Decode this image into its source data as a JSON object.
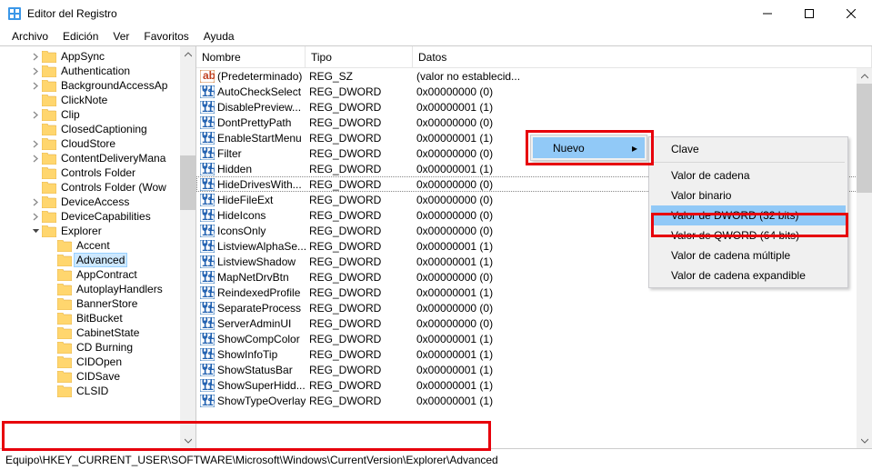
{
  "window": {
    "title": "Editor del Registro"
  },
  "menu": {
    "items": [
      "Archivo",
      "Edición",
      "Ver",
      "Favoritos",
      "Ayuda"
    ]
  },
  "tree": {
    "items": [
      {
        "label": "AppSync",
        "chev": "r"
      },
      {
        "label": "Authentication",
        "chev": "r"
      },
      {
        "label": "BackgroundAccessAp",
        "chev": "r"
      },
      {
        "label": "ClickNote",
        "chev": ""
      },
      {
        "label": "Clip",
        "chev": "r"
      },
      {
        "label": "ClosedCaptioning",
        "chev": ""
      },
      {
        "label": "CloudStore",
        "chev": "r"
      },
      {
        "label": "ContentDeliveryMana",
        "chev": "r"
      },
      {
        "label": "Controls Folder",
        "chev": ""
      },
      {
        "label": "Controls Folder (Wow",
        "chev": ""
      },
      {
        "label": "DeviceAccess",
        "chev": "r"
      },
      {
        "label": "DeviceCapabilities",
        "chev": "r"
      },
      {
        "label": "Explorer",
        "chev": "d",
        "expanded": true,
        "children": [
          {
            "label": "Accent"
          },
          {
            "label": "Advanced",
            "selected": true
          },
          {
            "label": "AppContract"
          },
          {
            "label": "AutoplayHandlers"
          },
          {
            "label": "BannerStore"
          },
          {
            "label": "BitBucket"
          },
          {
            "label": "CabinetState"
          },
          {
            "label": "CD Burning"
          },
          {
            "label": "CIDOpen"
          },
          {
            "label": "CIDSave"
          },
          {
            "label": "CLSID"
          }
        ]
      }
    ]
  },
  "list": {
    "columns": [
      "Nombre",
      "Tipo",
      "Datos"
    ],
    "rows": [
      {
        "icon": "str",
        "name": "(Predeterminado)",
        "type": "REG_SZ",
        "data": "(valor no establecid...",
        "sel": false
      },
      {
        "icon": "bin",
        "name": "AutoCheckSelect",
        "type": "REG_DWORD",
        "data": "0x00000000 (0)"
      },
      {
        "icon": "bin",
        "name": "DisablePreview...",
        "type": "REG_DWORD",
        "data": "0x00000001 (1)"
      },
      {
        "icon": "bin",
        "name": "DontPrettyPath",
        "type": "REG_DWORD",
        "data": "0x00000000 (0)"
      },
      {
        "icon": "bin",
        "name": "EnableStartMenu",
        "type": "REG_DWORD",
        "data": "0x00000001 (1)"
      },
      {
        "icon": "bin",
        "name": "Filter",
        "type": "REG_DWORD",
        "data": "0x00000000 (0)"
      },
      {
        "icon": "bin",
        "name": "Hidden",
        "type": "REG_DWORD",
        "data": "0x00000001 (1)"
      },
      {
        "icon": "bin",
        "name": "HideDrivesWith...",
        "type": "REG_DWORD",
        "data": "0x00000000 (0)",
        "sel": true
      },
      {
        "icon": "bin",
        "name": "HideFileExt",
        "type": "REG_DWORD",
        "data": "0x00000000 (0)"
      },
      {
        "icon": "bin",
        "name": "HideIcons",
        "type": "REG_DWORD",
        "data": "0x00000000 (0)"
      },
      {
        "icon": "bin",
        "name": "IconsOnly",
        "type": "REG_DWORD",
        "data": "0x00000000 (0)"
      },
      {
        "icon": "bin",
        "name": "ListviewAlphaSe...",
        "type": "REG_DWORD",
        "data": "0x00000001 (1)"
      },
      {
        "icon": "bin",
        "name": "ListviewShadow",
        "type": "REG_DWORD",
        "data": "0x00000001 (1)"
      },
      {
        "icon": "bin",
        "name": "MapNetDrvBtn",
        "type": "REG_DWORD",
        "data": "0x00000000 (0)"
      },
      {
        "icon": "bin",
        "name": "ReindexedProfile",
        "type": "REG_DWORD",
        "data": "0x00000001 (1)"
      },
      {
        "icon": "bin",
        "name": "SeparateProcess",
        "type": "REG_DWORD",
        "data": "0x00000000 (0)"
      },
      {
        "icon": "bin",
        "name": "ServerAdminUI",
        "type": "REG_DWORD",
        "data": "0x00000000 (0)"
      },
      {
        "icon": "bin",
        "name": "ShowCompColor",
        "type": "REG_DWORD",
        "data": "0x00000001 (1)"
      },
      {
        "icon": "bin",
        "name": "ShowInfoTip",
        "type": "REG_DWORD",
        "data": "0x00000001 (1)"
      },
      {
        "icon": "bin",
        "name": "ShowStatusBar",
        "type": "REG_DWORD",
        "data": "0x00000001 (1)"
      },
      {
        "icon": "bin",
        "name": "ShowSuperHidd...",
        "type": "REG_DWORD",
        "data": "0x00000001 (1)"
      },
      {
        "icon": "bin",
        "name": "ShowTypeOverlay",
        "type": "REG_DWORD",
        "data": "0x00000001 (1)"
      }
    ]
  },
  "context1": {
    "label": "Nuevo"
  },
  "context2": {
    "items1": [
      "Clave"
    ],
    "items2": [
      "Valor de cadena",
      "Valor binario",
      "Valor de DWORD (32 bits)",
      "Valor de QWORD (64 bits)",
      "Valor de cadena múltiple",
      "Valor de cadena expandible"
    ],
    "highlighted": "Valor de DWORD (32 bits)"
  },
  "path": "Equipo\\HKEY_CURRENT_USER\\SOFTWARE\\Microsoft\\Windows\\CurrentVersion\\Explorer\\Advanced"
}
